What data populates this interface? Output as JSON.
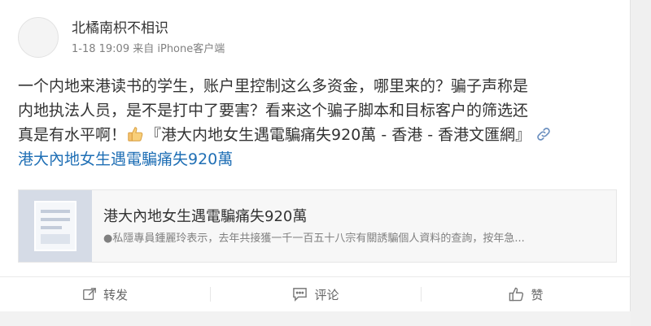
{
  "post": {
    "username": "北橘南枳不相识",
    "meta": "1-18 19:09 来自 iPhone客户端",
    "text_line1": "一个内地来港读书的学生，账户里控制这么多资金，哪里来的？骗子声称是",
    "text_line2": "内地执法人员，是不是打中了要害？看来这个骗子脚本和目标客户的筛选还",
    "text_line3_before": "真是有水平啊！",
    "text_line3_after": "『港大内地女生遇電騙痛失920萬 - 香港 - 香港文匯網』",
    "link_text": "港大內地女生遇電騙痛失920萬"
  },
  "link_card": {
    "title": "港大內地女生遇電騙痛失920萬",
    "description": "●私隱專員鍾麗玲表示，去年共接獲一千一百五十八宗有關誘騙個人資料的查詢，按年急..."
  },
  "actions": {
    "repost": "转发",
    "comment": "评论",
    "like": "赞"
  },
  "icons": {
    "avatar": "avatar-placeholder",
    "thumb": "thumbs-up-emoji",
    "link": "link-icon",
    "repost": "repost-icon",
    "comment": "comment-icon",
    "like": "like-icon",
    "article": "article-thumbnail-icon"
  },
  "colors": {
    "link": "#1f6fb5",
    "text": "#333333",
    "muted": "#808080"
  }
}
